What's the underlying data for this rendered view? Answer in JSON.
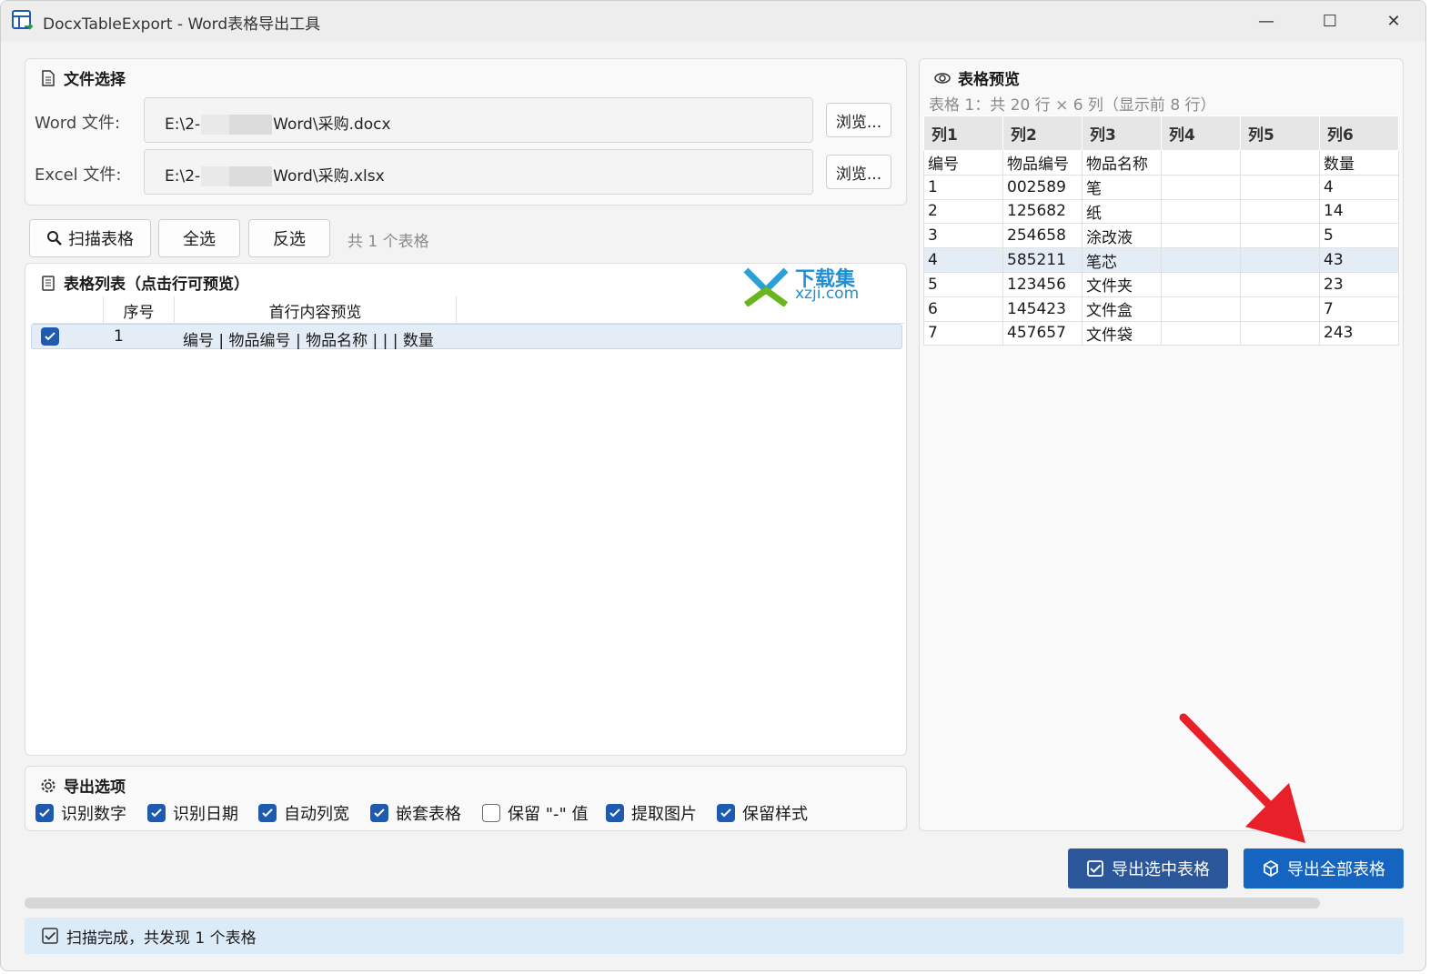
{
  "window": {
    "title": "DocxTableExport - Word表格导出工具",
    "minimize": "—",
    "maximize": "☐",
    "close": "✕"
  },
  "file_section": {
    "title": "文件选择",
    "word_label": "Word 文件:",
    "word_path_start": "E:\\2-",
    "word_path_end": "Word\\采购.docx",
    "excel_label": "Excel 文件:",
    "excel_path_start": "E:\\2-",
    "excel_path_end": "Word\\采购.xlsx",
    "browse_label": "浏览..."
  },
  "toolbar": {
    "scan_label": "扫描表格",
    "select_all_label": "全选",
    "invert_label": "反选",
    "count_text": "共 1 个表格"
  },
  "table_list": {
    "title": "表格列表（点击行可预览）",
    "columns": [
      "序号",
      "首行内容预览"
    ],
    "rows": [
      {
        "checked": true,
        "index": "1",
        "preview": "编号 | 物品编号 | 物品名称 | | | 数量"
      }
    ]
  },
  "watermark": {
    "brand": "下载集",
    "domain": "xzji.com"
  },
  "export_options": {
    "title": "导出选项",
    "items": [
      {
        "label": "识别数字",
        "checked": true
      },
      {
        "label": "识别日期",
        "checked": true
      },
      {
        "label": "自动列宽",
        "checked": true
      },
      {
        "label": "嵌套表格",
        "checked": true
      },
      {
        "label": "保留 \"-\" 值",
        "checked": false
      },
      {
        "label": "提取图片",
        "checked": true
      },
      {
        "label": "保留样式",
        "checked": true
      }
    ]
  },
  "preview": {
    "title": "表格预览",
    "subtitle": "表格 1：共 20 行 × 6 列（显示前 8 行）",
    "headers": [
      "列1",
      "列2",
      "列3",
      "列4",
      "列5",
      "列6"
    ],
    "rows": [
      [
        "编号",
        "物品编号",
        "物品名称",
        "",
        "",
        "数量"
      ],
      [
        "1",
        "002589",
        "笔",
        "",
        "",
        "4"
      ],
      [
        "2",
        "125682",
        "纸",
        "",
        "",
        "14"
      ],
      [
        "3",
        "254658",
        "涂改液",
        "",
        "",
        "5"
      ],
      [
        "4",
        "585211",
        "笔芯",
        "",
        "",
        "43"
      ],
      [
        "5",
        "123456",
        "文件夹",
        "",
        "",
        "23"
      ],
      [
        "6",
        "145423",
        "文件盒",
        "",
        "",
        "7"
      ],
      [
        "7",
        "457657",
        "文件袋",
        "",
        "",
        "243"
      ]
    ],
    "selected_row": 4
  },
  "export": {
    "selected_label": "导出选中表格",
    "all_label": "导出全部表格",
    "selected_color": "#2b579a",
    "all_color": "#1565c0"
  },
  "status": {
    "text": "扫描完成，共发现 1 个表格",
    "progress": 0
  }
}
